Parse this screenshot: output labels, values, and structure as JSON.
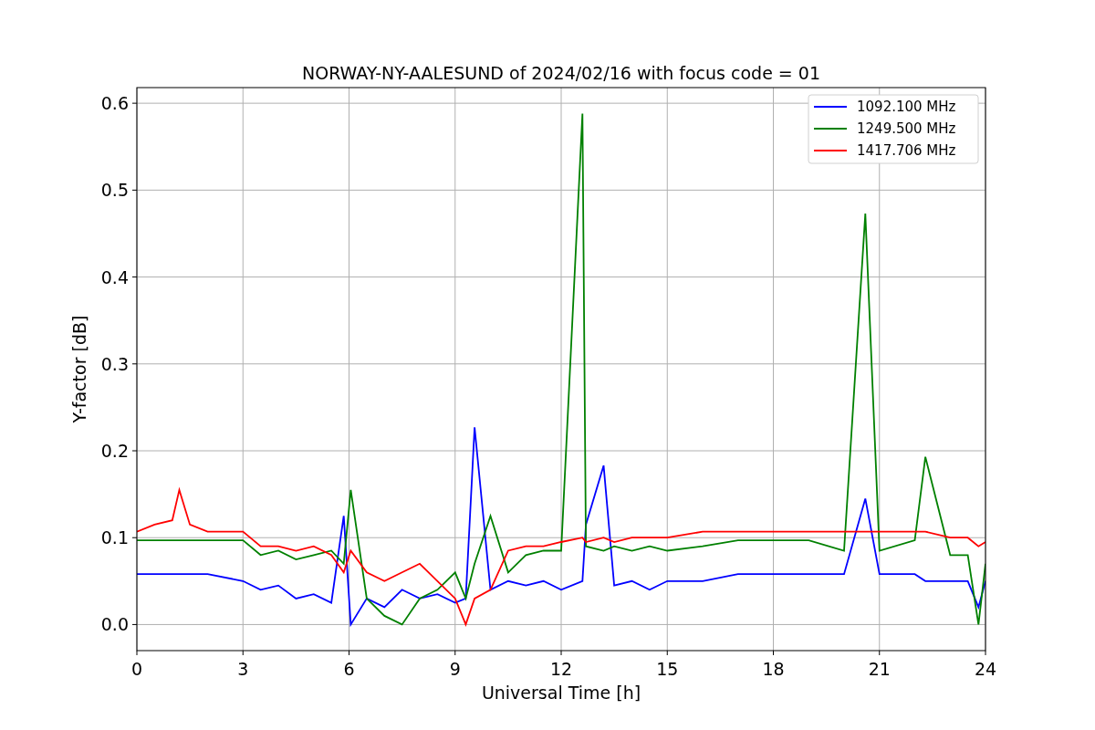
{
  "chart_data": {
    "type": "line",
    "title": "NORWAY-NY-AALESUND of 2024/02/16 with focus code = 01",
    "xlabel": "Universal Time [h]",
    "ylabel": "Y-factor [dB]",
    "x": [
      0,
      0.5,
      1,
      1.2,
      1.5,
      2,
      3,
      3.5,
      4,
      4.5,
      5,
      5.5,
      5.85,
      6.05,
      6.5,
      7,
      7.5,
      8,
      8.5,
      9,
      9.3,
      9.55,
      10,
      10.5,
      11,
      11.5,
      12,
      12.6,
      12.7,
      13.2,
      13.5,
      14,
      14.5,
      15,
      16,
      17,
      18,
      19,
      20,
      20.6,
      21,
      22,
      22.3,
      23,
      23.5,
      23.8,
      24
    ],
    "series": [
      {
        "name": "1092.100 MHz",
        "color": "#0000ff",
        "values": [
          0.058,
          0.058,
          0.058,
          0.058,
          0.058,
          0.058,
          0.05,
          0.04,
          0.045,
          0.03,
          0.035,
          0.025,
          0.125,
          0.0,
          0.03,
          0.02,
          0.04,
          0.03,
          0.035,
          0.025,
          0.03,
          0.227,
          0.04,
          0.05,
          0.045,
          0.05,
          0.04,
          0.05,
          0.115,
          0.183,
          0.045,
          0.05,
          0.04,
          0.05,
          0.05,
          0.058,
          0.058,
          0.058,
          0.058,
          0.145,
          0.058,
          0.058,
          0.05,
          0.05,
          0.05,
          0.02,
          0.05
        ]
      },
      {
        "name": "1249.500 MHz",
        "color": "#008000",
        "values": [
          0.097,
          0.097,
          0.097,
          0.097,
          0.097,
          0.097,
          0.097,
          0.08,
          0.085,
          0.075,
          0.08,
          0.085,
          0.07,
          0.155,
          0.03,
          0.01,
          0.0,
          0.03,
          0.04,
          0.06,
          0.03,
          0.07,
          0.125,
          0.06,
          0.08,
          0.085,
          0.085,
          0.588,
          0.09,
          0.085,
          0.09,
          0.085,
          0.09,
          0.085,
          0.09,
          0.097,
          0.097,
          0.097,
          0.085,
          0.473,
          0.085,
          0.097,
          0.193,
          0.08,
          0.08,
          0.0,
          0.07
        ]
      },
      {
        "name": "1417.706 MHz",
        "color": "#ff0000",
        "values": [
          0.107,
          0.115,
          0.12,
          0.155,
          0.115,
          0.107,
          0.107,
          0.09,
          0.09,
          0.085,
          0.09,
          0.08,
          0.06,
          0.085,
          0.06,
          0.05,
          0.06,
          0.07,
          0.05,
          0.03,
          0.0,
          0.03,
          0.04,
          0.085,
          0.09,
          0.09,
          0.095,
          0.1,
          0.095,
          0.1,
          0.095,
          0.1,
          0.1,
          0.1,
          0.107,
          0.107,
          0.107,
          0.107,
          0.107,
          0.107,
          0.107,
          0.107,
          0.107,
          0.1,
          0.1,
          0.09,
          0.095
        ]
      }
    ],
    "xlim": [
      0,
      24
    ],
    "ylim": [
      -0.03,
      0.618
    ],
    "grid": true,
    "legend": true,
    "xticks": [
      0,
      3,
      6,
      9,
      12,
      15,
      18,
      21,
      24
    ],
    "yticks": [
      {
        "value": 0,
        "label": "0.0"
      },
      {
        "value": 0.1,
        "label": "0.1"
      },
      {
        "value": 0.2,
        "label": "0.2"
      },
      {
        "value": 0.3,
        "label": "0.3"
      },
      {
        "value": 0.4,
        "label": "0.4"
      },
      {
        "value": 0.5,
        "label": "0.5"
      },
      {
        "value": 0.6,
        "label": "0.6"
      }
    ]
  }
}
